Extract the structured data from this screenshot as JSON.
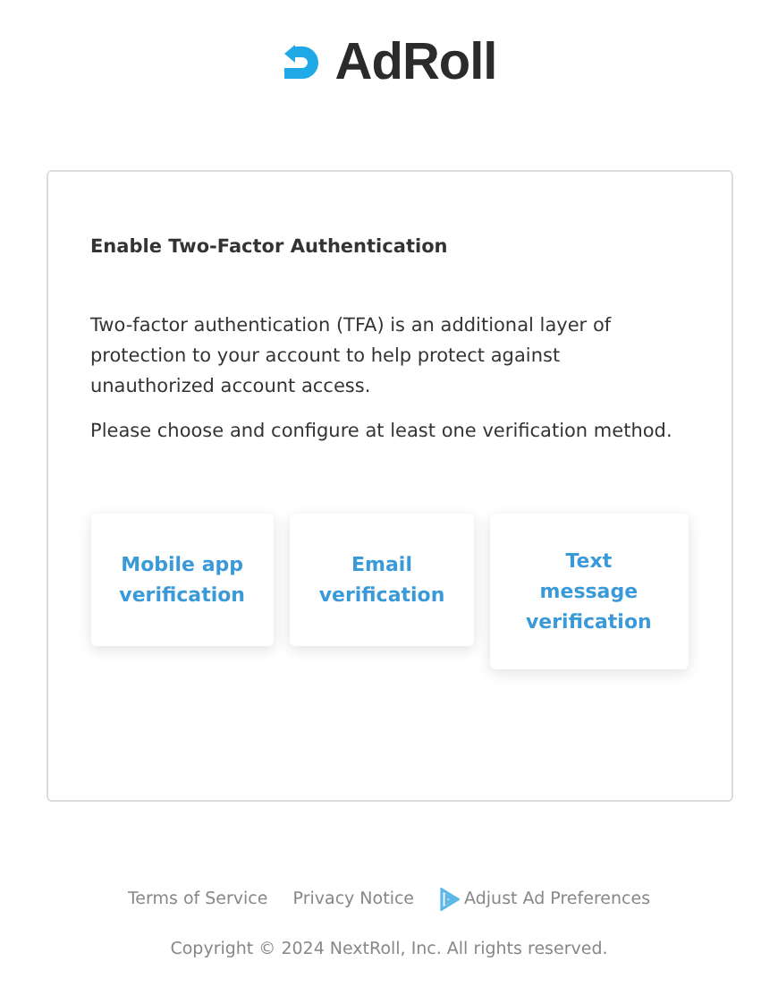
{
  "logo": {
    "text": "AdRoll"
  },
  "card": {
    "heading": "Enable Two-Factor Authentication",
    "paragraphs": [
      "Two-factor authentication (TFA) is an additional layer of protection to your account to help protect against unauthorized account access.",
      "Please choose and configure at least one verification method."
    ],
    "methods": [
      {
        "label": "Mobile app verification",
        "kind": "narrow"
      },
      {
        "label": "Email verification",
        "kind": "narrow"
      },
      {
        "label": "Text message verification",
        "kind": "wide"
      }
    ]
  },
  "footer": {
    "links": [
      {
        "label": "Terms of Service",
        "kind": "plain"
      },
      {
        "label": "Privacy Notice",
        "kind": "plain"
      },
      {
        "label": "Adjust Ad Preferences",
        "kind": "adchoices"
      }
    ],
    "copyright": "Copyright © 2024 NextRoll, Inc. All rights reserved."
  }
}
